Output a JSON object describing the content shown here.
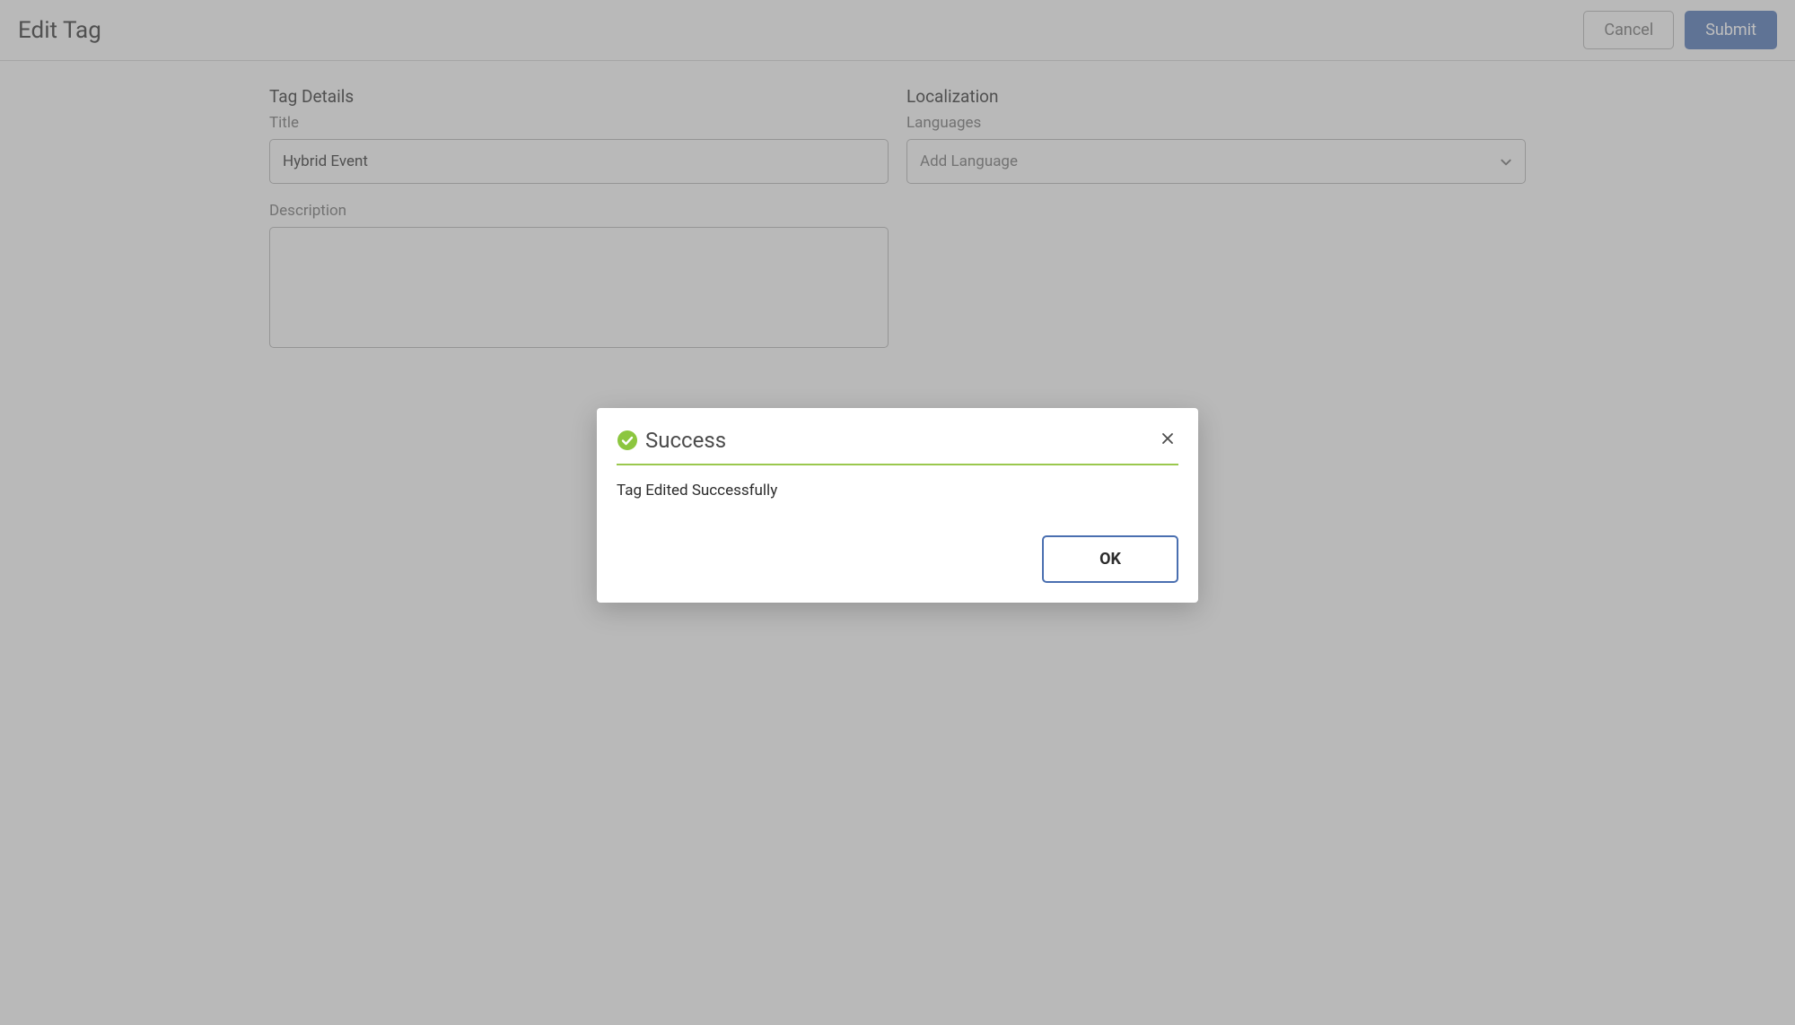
{
  "header": {
    "title": "Edit Tag",
    "cancel_label": "Cancel",
    "submit_label": "Submit"
  },
  "tag_details": {
    "section_title": "Tag Details",
    "title_label": "Title",
    "title_value": "Hybrid Event",
    "description_label": "Description",
    "description_value": ""
  },
  "localization": {
    "section_title": "Localization",
    "languages_label": "Languages",
    "add_language_label": "Add Language"
  },
  "dialog": {
    "title": "Success",
    "message": "Tag Edited Successfully",
    "ok_label": "OK"
  }
}
